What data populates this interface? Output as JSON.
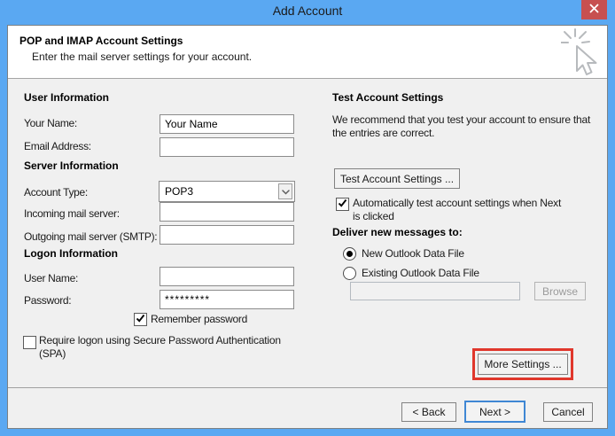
{
  "window": {
    "title": "Add Account"
  },
  "header": {
    "title": "POP and IMAP Account Settings",
    "subtitle": "Enter the mail server settings for your account."
  },
  "left": {
    "user_heading": "User Information",
    "your_name_label": "Your Name:",
    "your_name_value": "Your Name",
    "email_label": "Email Address:",
    "email_value": "",
    "server_heading": "Server Information",
    "account_type_label": "Account Type:",
    "account_type_value": "POP3",
    "incoming_label": "Incoming mail server:",
    "incoming_value": "",
    "outgoing_label": "Outgoing mail server (SMTP):",
    "outgoing_value": "",
    "logon_heading": "Logon Information",
    "user_name_label": "User Name:",
    "user_name_value": "",
    "password_label": "Password:",
    "password_value": "*********",
    "remember_label": "Remember password",
    "remember_checked": true,
    "spa_line1": "Require logon using Secure Password Authentication",
    "spa_line2": "(SPA)",
    "spa_checked": false
  },
  "right": {
    "test_heading": "Test Account Settings",
    "description_line1": "We recommend that you test your account to ensure that",
    "description_line2": "the entries are correct.",
    "test_button_label": "Test Account Settings ...",
    "auto_test_line1": "Automatically test account settings when Next",
    "auto_test_line2": "is clicked",
    "auto_test_checked": true,
    "deliver_heading": "Deliver new messages to:",
    "new_file_label": "New Outlook Data File",
    "new_file_selected": true,
    "existing_file_label": "Existing Outlook Data File",
    "existing_file_selected": false,
    "data_file_value": "",
    "browse_label": "Browse",
    "more_settings_label": "More Settings ..."
  },
  "footer": {
    "back_label": "< Back",
    "next_label": "Next >",
    "cancel_label": "Cancel"
  },
  "colors": {
    "titlebar_blue": "#5aa8f2",
    "close_red": "#c75050",
    "annotation_red": "#e0372c",
    "body_gray": "#f0f0f0",
    "header_white": "#ffffff",
    "default_button_blue": "#3f87d4"
  }
}
